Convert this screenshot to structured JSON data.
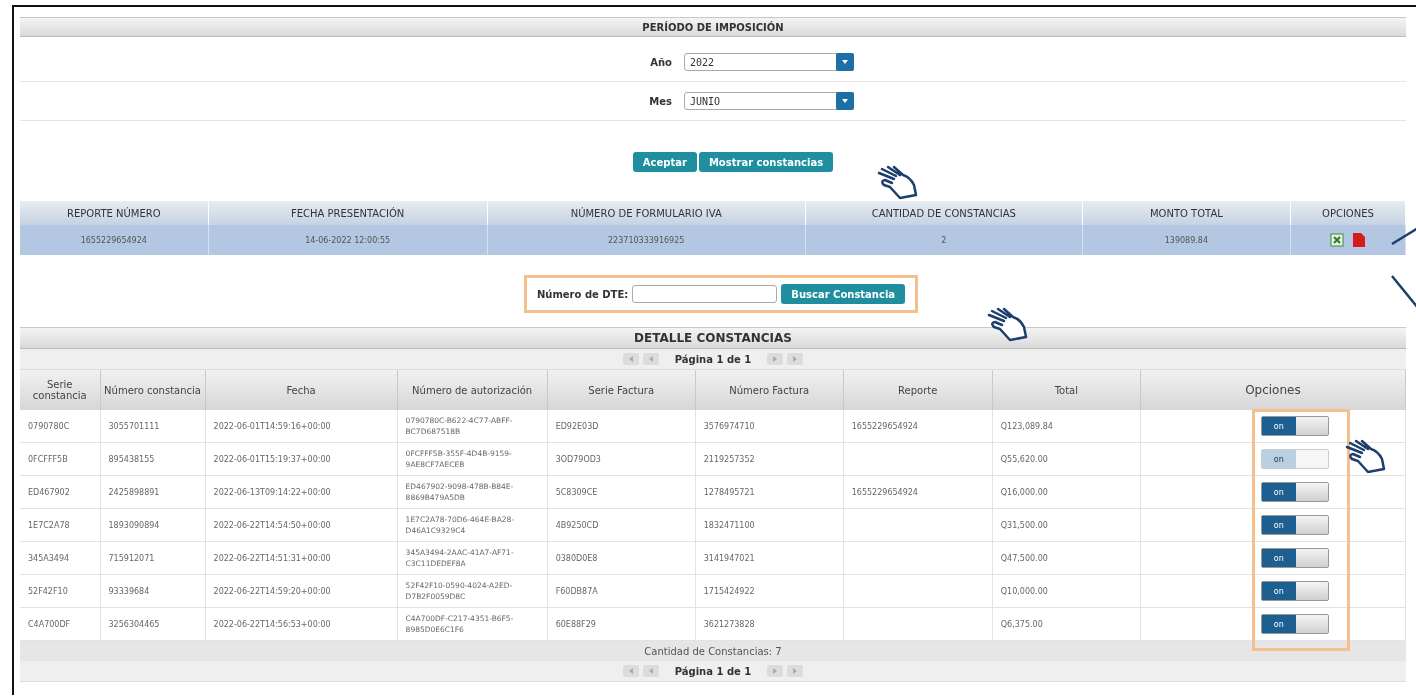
{
  "period": {
    "title": "PERÍODO DE IMPOSICIÓN",
    "fields": [
      {
        "label": "Año",
        "value": "2022"
      },
      {
        "label": "Mes",
        "value": "JUNIO"
      }
    ],
    "buttons": [
      "Aceptar",
      "Mostrar constancias"
    ]
  },
  "report": {
    "columns": [
      "REPORTE NÚMERO",
      "FECHA PRESENTACIÓN",
      "NÚMERO DE FORMULARIO IVA",
      "CANTIDAD DE CONSTANCIAS",
      "MONTO TOTAL",
      "OPCIONES"
    ],
    "rows": [
      {
        "cells": [
          "1655229654924",
          "14-06-2022 12:00:55",
          "223710333916925",
          "2",
          "139089.84"
        ],
        "selected": true
      }
    ]
  },
  "search": {
    "label": "Número de DTE:",
    "button": "Buscar Constancia"
  },
  "detail": {
    "title": "DETALLE CONSTANCIAS",
    "pager": "Página 1 de 1",
    "columns": [
      "Serie constancia",
      "Número constancia",
      "Fecha",
      "Número de autorización",
      "Serie Factura",
      "Número Factura",
      "Reporte",
      "Total",
      "Opciones"
    ],
    "rows": [
      {
        "cells": [
          "0790780C",
          "3055701111",
          "2022-06-01T14:59:16+00:00",
          "0790780C-B622-4C77-ABFF-BC7D687518B",
          "ED92E03D",
          "3576974710",
          "1655229654924",
          "Q123,089.84"
        ],
        "toggle": {
          "label": "on",
          "disabled": false
        }
      },
      {
        "cells": [
          "0FCFFF5B",
          "895438155",
          "2022-06-01T15:19:37+00:00",
          "0FCFFF5B-355F-4D4B-9159-9AE8CF7AECEB",
          "3OD79OD3",
          "2119257352",
          "",
          "Q55,620.00"
        ],
        "toggle": {
          "label": "on",
          "disabled": true
        }
      },
      {
        "cells": [
          "ED467902",
          "2425898891",
          "2022-06-13T09:14:22+00:00",
          "ED467902-9098-478B-B84E-8869B479A5DB",
          "5C8309CE",
          "1278495721",
          "1655229654924",
          "Q16,000.00"
        ],
        "toggle": {
          "label": "on",
          "disabled": false
        }
      },
      {
        "cells": [
          "1E7C2A78",
          "1893090894",
          "2022-06-22T14:54:50+00:00",
          "1E7C2A78-70D6-464E-BA28-D46A1C9329C4",
          "4B9250CD",
          "1832471100",
          "",
          "Q31,500.00"
        ],
        "toggle": {
          "label": "on",
          "disabled": false
        }
      },
      {
        "cells": [
          "345A3494",
          "715912071",
          "2022-06-22T14:51:31+00:00",
          "345A3494-2AAC-41A7-AF71-C3C11DEDEF8A",
          "0380D0E8",
          "3141947021",
          "",
          "Q47,500.00"
        ],
        "toggle": {
          "label": "on",
          "disabled": false
        }
      },
      {
        "cells": [
          "52F42F10",
          "93339684",
          "2022-06-22T14:59:20+00:00",
          "52F42F10-0590-4024-A2ED-D7B2F0059D8C",
          "F60DB87A",
          "1715424922",
          "",
          "Q10,000.00"
        ],
        "toggle": {
          "label": "on",
          "disabled": false
        }
      },
      {
        "cells": [
          "C4A700DF",
          "3256304465",
          "2022-06-22T14:56:53+00:00",
          "C4A700DF-C217-4351-B6F5-8985D0E6C1F6",
          "60E88F29",
          "3621273828",
          "",
          "Q6,375.00"
        ],
        "toggle": {
          "label": "on",
          "disabled": false
        }
      }
    ],
    "footer": "Cantidad de Constancias: 7",
    "pager_bottom": "Página 1 de 1"
  }
}
